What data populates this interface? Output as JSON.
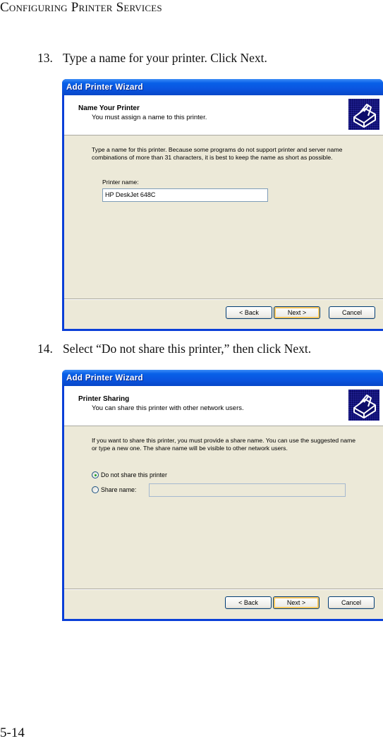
{
  "running_head": "Configuring Printer Services",
  "page_number": "5-14",
  "steps": [
    {
      "number": "13.",
      "text": "Type a name for your printer. Click Next."
    },
    {
      "number": "14.",
      "text": "Select “Do not share this printer,” then click Next."
    }
  ],
  "dialog1": {
    "title": "Add Printer Wizard",
    "header_title": "Name Your Printer",
    "header_subtitle": "You must assign a name to this printer.",
    "icon": "printer-icon",
    "body_text": "Type a name for this printer. Because some programs do not support printer and server name combinations of more than 31 characters, it is best to keep the name as short as possible.",
    "field_label": "Printer name:",
    "field_value": "HP DeskJet 648C",
    "buttons": {
      "back": "< Back",
      "next": "Next >",
      "cancel": "Cancel"
    }
  },
  "dialog2": {
    "title": "Add Printer Wizard",
    "header_title": "Printer Sharing",
    "header_subtitle": "You can share this printer with other network users.",
    "icon": "printer-icon",
    "body_text": "If you want to share this printer, you must provide a share name. You can use the suggested name or type a new one. The share name will be visible to other network users.",
    "options": [
      {
        "label": "Do not share this printer",
        "selected": true
      },
      {
        "label": "Share name:",
        "selected": false
      }
    ],
    "share_name_value": "",
    "buttons": {
      "back": "< Back",
      "next": "Next >",
      "cancel": "Cancel"
    }
  }
}
